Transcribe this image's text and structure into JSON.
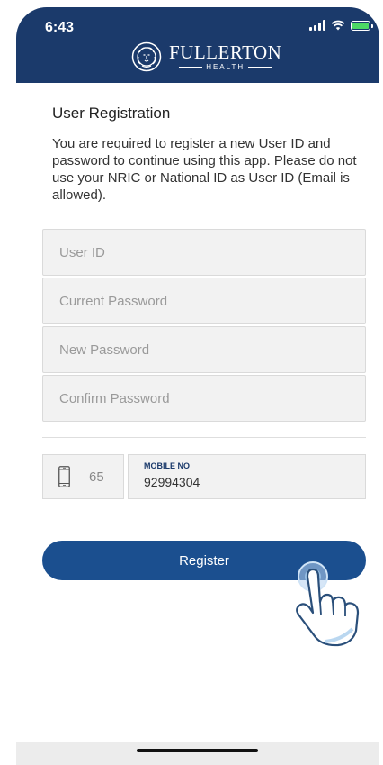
{
  "status_bar": {
    "time": "6:43"
  },
  "brand": {
    "name": "FULLERTON",
    "sub": "HEALTH"
  },
  "form": {
    "title": "User Registration",
    "description": "You are required to register a new User ID and password to continue using this app. Please do not use your NRIC or National ID as User ID (Email is allowed).",
    "fields": [
      {
        "placeholder": "User ID"
      },
      {
        "placeholder": "Current Password"
      },
      {
        "placeholder": "New Password"
      },
      {
        "placeholder": "Confirm Password"
      }
    ],
    "country_code": "65",
    "mobile_label": "MOBILE NO",
    "mobile_value": "92994304",
    "register_label": "Register"
  },
  "colors": {
    "brand_blue": "#1b3a6b",
    "button_blue": "#1b4f8f"
  },
  "icons": [
    "signal-icon",
    "wifi-icon",
    "battery-icon",
    "lion-logo-icon",
    "mobile-phone-icon",
    "tap-hand-icon"
  ]
}
